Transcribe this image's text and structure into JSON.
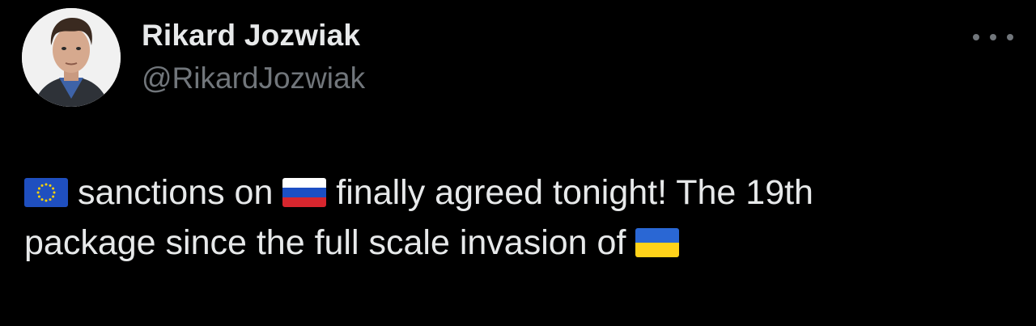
{
  "author": {
    "display_name": "Rikard Jozwiak",
    "handle": "@RikardJozwiak"
  },
  "more_menu": {
    "icon": "more-horizontal-icon"
  },
  "tweet": {
    "line1": {
      "segment1": "sanctions on",
      "segment2": "finally agreed tonight! The 19th"
    },
    "line2": {
      "segment1": "package since the full scale invasion of"
    },
    "flags": {
      "eu": "🇪🇺",
      "russia": "🇷🇺",
      "ukraine": "🇺🇦"
    }
  },
  "colors": {
    "background": "#000000",
    "primary_text": "#e7e9ea",
    "secondary_text": "#71767b"
  }
}
